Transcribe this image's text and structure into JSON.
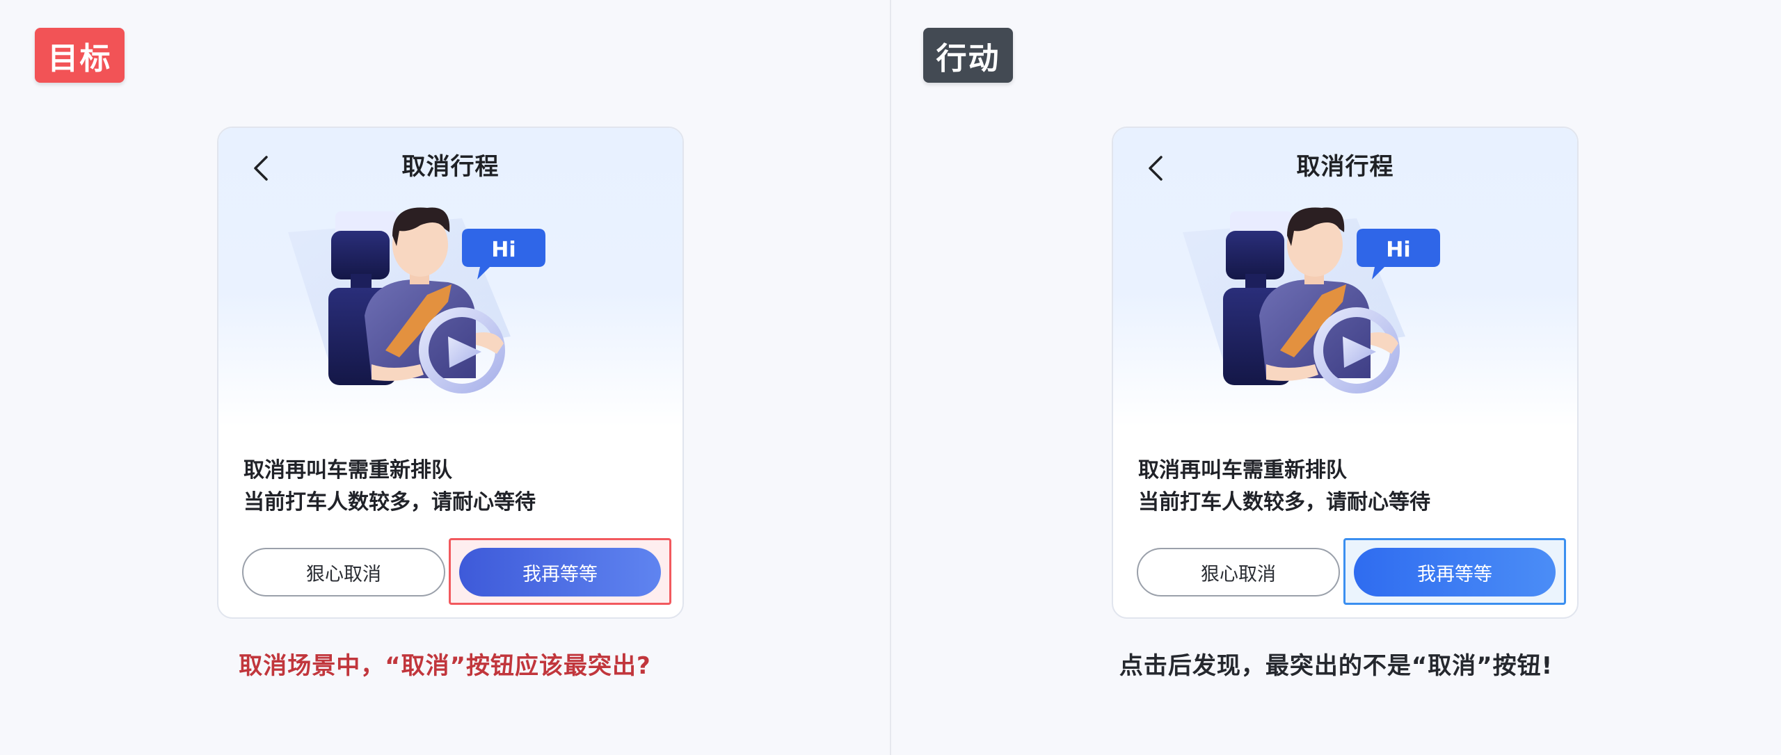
{
  "left": {
    "tag": "目标",
    "tag_color": "#f25356",
    "card": {
      "title": "取消行程",
      "bubble_text": "Hi",
      "message_line1": "取消再叫车需重新排队",
      "message_line2": "当前打车人数较多，请耐心等待",
      "cancel_label": "狠心取消",
      "wait_label": "我再等等"
    },
    "caption": "取消场景中，“取消”按钮应该最突出?",
    "highlight_color": "#f2595e"
  },
  "right": {
    "tag": "行动",
    "tag_color": "#434a53",
    "card": {
      "title": "取消行程",
      "bubble_text": "Hi",
      "message_line1": "取消再叫车需重新排队",
      "message_line2": "当前打车人数较多，请耐心等待",
      "cancel_label": "狠心取消",
      "wait_label": "我再等等"
    },
    "caption": "点击后发现，最突出的不是“取消”按钮!",
    "highlight_color": "#3b8ff0"
  },
  "icons": {
    "back": "chevron-left-icon",
    "illustration": "driver-illustration"
  }
}
